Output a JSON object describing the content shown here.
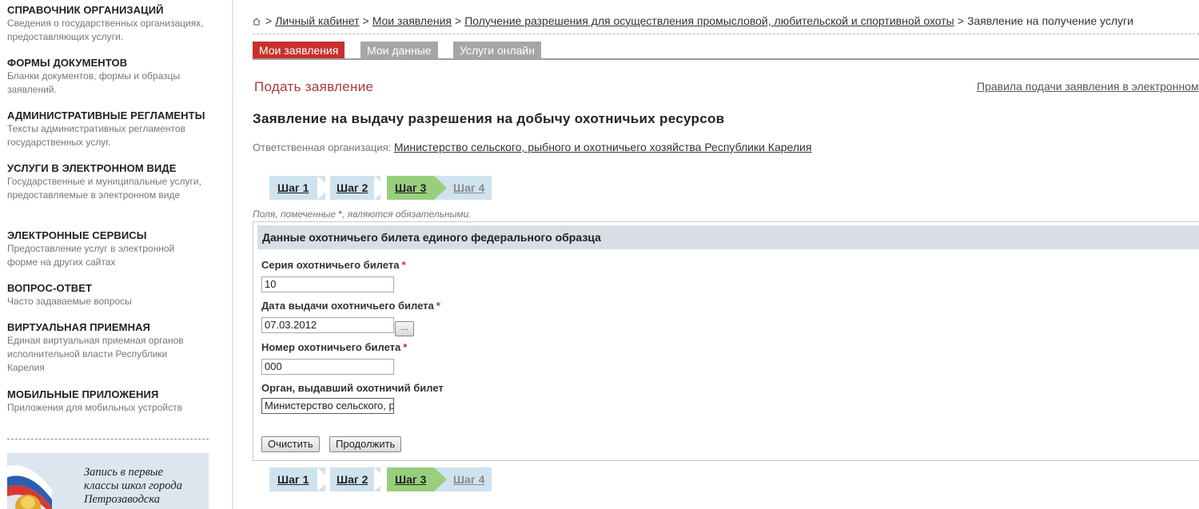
{
  "sidebar": {
    "items": [
      {
        "title": "СПРАВОЧНИК ОРГАНИЗАЦИЙ",
        "desc": "Сведения о государственных организациях, предоставляющих услуги."
      },
      {
        "title": "ФОРМЫ ДОКУМЕНТОВ",
        "desc": "Бланки документов, формы и образцы заявлений."
      },
      {
        "title": "АДМИНИСТРАТИВНЫЕ РЕГЛАМЕНТЫ",
        "desc": "Тексты административных регламентов государственных услуг."
      },
      {
        "title": "УСЛУГИ В ЭЛЕКТРОННОМ ВИДЕ",
        "desc": "Государственные и муниципальные услуги, предоставляемые в электронном виде"
      },
      {
        "title": "ЭЛЕКТРОННЫЕ СЕРВИСЫ",
        "desc": "Предоставление услуг в электронной форме на других сайтах"
      },
      {
        "title": "ВОПРОС-ОТВЕТ",
        "desc": "Часто задаваемые вопросы"
      },
      {
        "title": "ВИРТУАЛЬНАЯ ПРИЕМНАЯ",
        "desc": "Единая виртуальная приемная органов исполнительной власти Республики Карелия"
      },
      {
        "title": "МОБИЛЬНЫЕ ПРИЛОЖЕНИЯ",
        "desc": "Приложения для мобильных устройств"
      }
    ],
    "banner": {
      "line1": "Запись в первые",
      "line2": "классы школ города",
      "line3": "Петрозаводска"
    }
  },
  "breadcrumb": {
    "items": [
      "Личный кабинет",
      "Мои заявления",
      "Получение разрешения для осуществления промысловой, любительской и спортивной охоты"
    ],
    "current": "Заявление на получение услуги",
    "sep": ">"
  },
  "tabs": [
    {
      "label": "Мои заявления",
      "active": true
    },
    {
      "label": "Мои данные",
      "active": false
    },
    {
      "label": "Услуги онлайн",
      "active": false
    }
  ],
  "page": {
    "submit_title": "Подать заявление",
    "rules_link": "Правила подачи заявления в электронном",
    "form_title": "Заявление на выдачу разрешения на добычу охотничьих ресурсов",
    "org_label": "Ответственная организация:",
    "org_name": "Министерство сельского, рыбного и охотничьего хозяйства Республики Карелия"
  },
  "steps": [
    {
      "label": "Шаг 1",
      "state": "done"
    },
    {
      "label": "Шаг 2",
      "state": "done"
    },
    {
      "label": "Шаг 3",
      "state": "current"
    },
    {
      "label": "Шаг 4",
      "state": "future"
    }
  ],
  "form": {
    "required_note_pre": "Поля, помеченные ",
    "required_star": "*",
    "required_note_post": ", являются обязательными.",
    "section_title": "Данные охотничьего билета единого федерального образца",
    "fields": [
      {
        "label": "Серия охотничьего билета",
        "required": "*",
        "value": "10"
      },
      {
        "label": "Дата выдачи охотничьего билета",
        "required": "*",
        "value": "07.03.2012"
      },
      {
        "label": "Номер охотничьего билета",
        "required": "*",
        "value": "000"
      },
      {
        "label": "Орган, выдавший охотничий билет",
        "required": "",
        "value": "Министерство сельского, р"
      }
    ],
    "date_button": "...",
    "clear_button": "Очистить",
    "continue_button": "Продолжить"
  }
}
